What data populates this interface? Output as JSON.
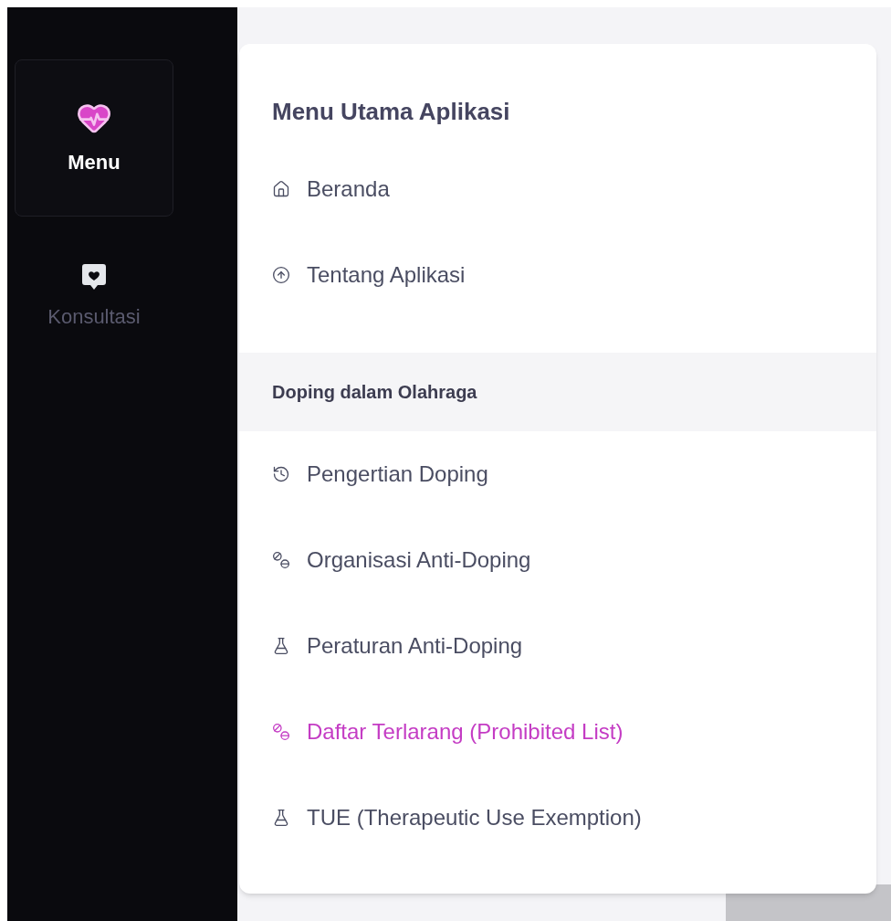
{
  "sidebar": {
    "items": [
      {
        "label": "Menu",
        "selected": true
      },
      {
        "label": "Konsultasi",
        "selected": false
      }
    ]
  },
  "menu": {
    "title": "Menu Utama Aplikasi",
    "items": [
      {
        "kind": "link",
        "label": "Beranda",
        "selected": false
      },
      {
        "kind": "link",
        "label": "Tentang Aplikasi",
        "selected": false
      },
      {
        "kind": "section",
        "label": "Doping dalam Olahraga"
      },
      {
        "kind": "link",
        "label": "Pengertian Doping",
        "selected": false
      },
      {
        "kind": "link",
        "label": "Organisasi Anti-Doping",
        "selected": false
      },
      {
        "kind": "link",
        "label": "Peraturan Anti-Doping",
        "selected": false
      },
      {
        "kind": "link",
        "label": "Daftar Terlarang (Prohibited List)",
        "selected": true
      },
      {
        "kind": "link",
        "label": "TUE (Therapeutic Use Exemption)",
        "selected": false
      }
    ]
  }
}
